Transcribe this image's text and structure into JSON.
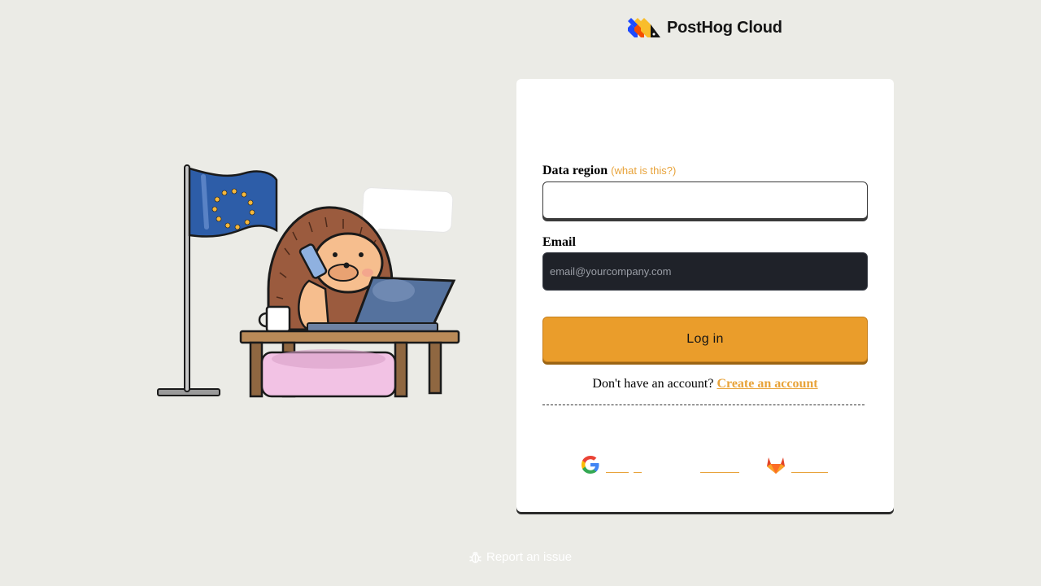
{
  "brand": {
    "name": "PostHog Cloud"
  },
  "form": {
    "region_label": "Data region",
    "region_hint": "(what is this?)",
    "region_value": "",
    "email_label": "Email",
    "email_placeholder": "email@yourcompany.com",
    "login_label": "Log in",
    "signup_prompt": "Don't have an account?",
    "signup_link": "Create an account"
  },
  "footer": {
    "report_label": "Report an issue",
    "report_icon": "bug-icon"
  },
  "sso": [
    {
      "name": "google-sso-button",
      "icon": "google-icon"
    },
    {
      "name": "github-sso-button",
      "icon": "github-icon"
    },
    {
      "name": "gitlab-sso-button",
      "icon": "gitlab-icon"
    }
  ],
  "colors": {
    "background": "#EBEBE6",
    "accent": "#EA9D2B",
    "link": "#E8A33A",
    "input_dark": "#1F2229"
  }
}
